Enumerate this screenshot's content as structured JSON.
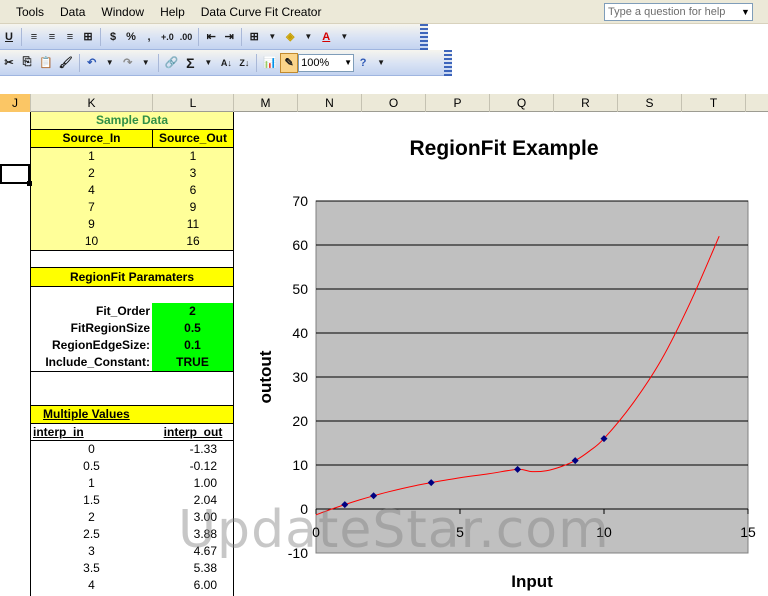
{
  "menubar": {
    "items": [
      "Tools",
      "Data",
      "Window",
      "Help",
      "Data Curve Fit Creator"
    ],
    "help_placeholder": "Type a question for help"
  },
  "toolbar": {
    "row1": [
      "U",
      "≡",
      "≡",
      "≡",
      "⊞",
      "$",
      "%",
      ",",
      "+.0",
      ".00",
      "⇤",
      "⇥",
      "⊞",
      "◈",
      "A"
    ],
    "row2": [
      "✂",
      "⎘",
      "📋",
      "🖌",
      "↶",
      "↷",
      "🔗",
      "Σ",
      "A↓",
      "Z↓",
      "📊",
      "✎"
    ],
    "zoom": "100%"
  },
  "columns": [
    {
      "label": "J",
      "selected": true
    },
    {
      "label": "K"
    },
    {
      "label": "L"
    },
    {
      "label": "M"
    },
    {
      "label": "N"
    },
    {
      "label": "O"
    },
    {
      "label": "P"
    },
    {
      "label": "Q"
    },
    {
      "label": "R"
    },
    {
      "label": "S"
    },
    {
      "label": "T"
    }
  ],
  "sample_data": {
    "title": "Sample Data",
    "headers": [
      "Source_In",
      "Source_Out"
    ],
    "rows": [
      [
        "1",
        "1"
      ],
      [
        "2",
        "3"
      ],
      [
        "4",
        "6"
      ],
      [
        "7",
        "9"
      ],
      [
        "9",
        "11"
      ],
      [
        "10",
        "16"
      ]
    ]
  },
  "params": {
    "title": "RegionFit Paramaters",
    "rows": [
      {
        "label": "Fit_Order",
        "value": "2"
      },
      {
        "label": "FitRegionSize",
        "value": "0.5"
      },
      {
        "label": "RegionEdgeSize:",
        "value": "0.1"
      },
      {
        "label": "Include_Constant:",
        "value": "TRUE"
      }
    ]
  },
  "multiple": {
    "title": "Multiple Values",
    "headers": [
      "interp_in",
      "interp_out"
    ],
    "rows": [
      [
        "0",
        "-1.33"
      ],
      [
        "0.5",
        "-0.12"
      ],
      [
        "1",
        "1.00"
      ],
      [
        "1.5",
        "2.04"
      ],
      [
        "2",
        "3.00"
      ],
      [
        "2.5",
        "3.88"
      ],
      [
        "3",
        "4.67"
      ],
      [
        "3.5",
        "5.38"
      ],
      [
        "4",
        "6.00"
      ]
    ]
  },
  "chart_data": {
    "type": "scatter",
    "title": "RegionFit Example",
    "xlabel": "Input",
    "ylabel": "outout",
    "xlim": [
      0,
      15
    ],
    "ylim": [
      -10,
      70
    ],
    "xticks": [
      0,
      5,
      10,
      15
    ],
    "yticks": [
      -10,
      0,
      10,
      20,
      30,
      40,
      50,
      60,
      70
    ],
    "grid": true,
    "plot_background": "#c0c0c0",
    "series": [
      {
        "kind": "points",
        "color": "#000080",
        "x": [
          1,
          2,
          4,
          7,
          9,
          10
        ],
        "y": [
          1,
          3,
          6,
          9,
          11,
          16
        ]
      },
      {
        "kind": "curve",
        "color": "#ff0000",
        "x": [
          0,
          0.5,
          1,
          1.5,
          2,
          2.5,
          3,
          3.5,
          4,
          5,
          6,
          7,
          7.5,
          8,
          8.5,
          9,
          9.5,
          10,
          11,
          12,
          13,
          14
        ],
        "y": [
          -1.33,
          -0.12,
          1.0,
          2.04,
          3.0,
          3.88,
          4.67,
          5.38,
          6.0,
          7.1,
          8.0,
          9.0,
          8.5,
          8.7,
          9.6,
          11.0,
          13.2,
          16.0,
          24.0,
          34.0,
          47.0,
          62.0
        ]
      }
    ]
  },
  "watermark": "UpdateStar.com"
}
